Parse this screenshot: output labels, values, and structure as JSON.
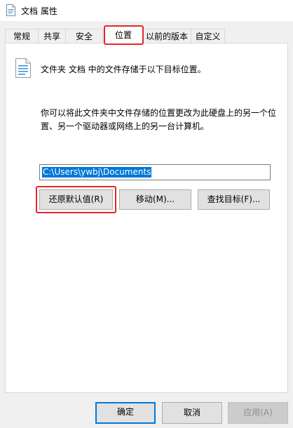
{
  "window": {
    "title": "文档 属性",
    "icon": "document-icon"
  },
  "tabs": [
    {
      "label": "常规",
      "active": false
    },
    {
      "label": "共享",
      "active": false
    },
    {
      "label": "安全",
      "active": false
    },
    {
      "label": "位置",
      "active": true
    },
    {
      "label": "以前的版本",
      "active": false
    },
    {
      "label": "自定义",
      "active": false
    }
  ],
  "location": {
    "info": "文件夹 文档 中的文件存储于以下目标位置。",
    "description": "你可以将此文件夹中文件存储的位置更改为此硬盘上的另一个位置、另一个驱动器或网络上的另一台计算机。",
    "path_value": "C:\\Users\\ywbj\\Documents",
    "buttons": {
      "restore": "还原默认值(R)",
      "move": "移动(M)...",
      "find_target": "查找目标(F)..."
    }
  },
  "footer": {
    "ok": "确定",
    "cancel": "取消",
    "apply": "应用(A)"
  },
  "colors": {
    "accent": "#0078d7",
    "highlight": "#e5262c"
  }
}
